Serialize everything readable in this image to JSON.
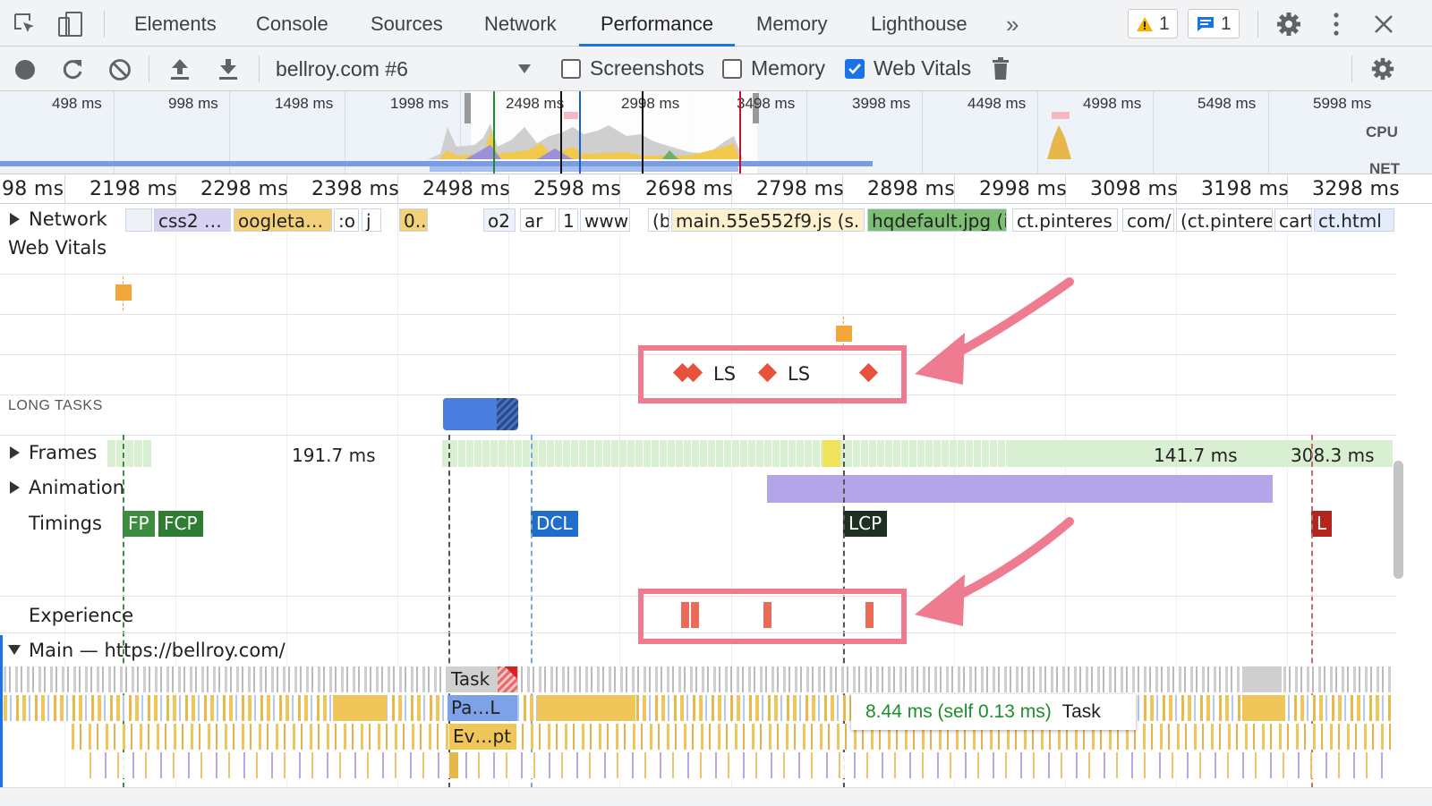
{
  "tabs": [
    "Elements",
    "Console",
    "Sources",
    "Network",
    "Performance",
    "Memory",
    "Lighthouse"
  ],
  "active_tab": "Performance",
  "more_tabs_glyph": "»",
  "warning_count": "1",
  "message_count": "1",
  "toolbar": {
    "profile_select": "bellroy.com #6",
    "screenshots_label": "Screenshots",
    "screenshots_checked": false,
    "memory_label": "Memory",
    "memory_checked": false,
    "webvitals_label": "Web Vitals",
    "webvitals_checked": true
  },
  "overview": {
    "ticks": [
      "498 ms",
      "998 ms",
      "1498 ms",
      "1998 ms",
      "2498 ms",
      "2998 ms",
      "3498 ms",
      "3998 ms",
      "4498 ms",
      "4998 ms",
      "5498 ms",
      "5998 ms"
    ],
    "cpu_label": "CPU",
    "net_label": "NET"
  },
  "ruler": [
    "98 ms",
    "2198 ms",
    "2298 ms",
    "2398 ms",
    "2498 ms",
    "2598 ms",
    "2698 ms",
    "2798 ms",
    "2898 ms",
    "2998 ms",
    "3098 ms",
    "3198 ms",
    "3298 ms"
  ],
  "tracks": {
    "network": "Network",
    "web_vitals": "Web Vitals",
    "long_tasks": "LONG TASKS",
    "frames": "Frames",
    "animation": "Animation",
    "timings": "Timings",
    "experience": "Experience",
    "main": "Main — https://bellroy.com/"
  },
  "network_items": [
    "css2 …",
    "oogleta…",
    ":o",
    "j",
    "0..",
    "o2",
    "ar",
    "1",
    "www",
    "(b",
    "main.55e552f9.js (s.",
    "hqdefault.jpg (i",
    "ct.pinteres",
    "com/",
    "(ct.pintere",
    "cart",
    "ct.html"
  ],
  "layout_shift_labels": [
    "LS",
    "LS"
  ],
  "frames": {
    "frame1": "191.7 ms",
    "frame2": "141.7 ms",
    "frame3": "308.3 ms"
  },
  "timings": {
    "fp": "FP",
    "fcp": "FCP",
    "dcl": "DCL",
    "lcp": "LCP",
    "l": "L"
  },
  "flame": {
    "task": "Task",
    "pa": "Pa…L",
    "ev": "Ev…pt"
  },
  "tooltip": {
    "time": "8.44 ms (self 0.13 ms)",
    "name": "Task"
  },
  "colors": {
    "accent": "#1a73e8",
    "annotation": "#ee7b90",
    "layout_shift": "#e8513b",
    "fp": "#3c8d40",
    "dcl": "#1f6ecb",
    "lcp": "#1d3022",
    "l": "#b3261e",
    "animation": "#b4a5e8",
    "frames": "#d9efd1"
  }
}
